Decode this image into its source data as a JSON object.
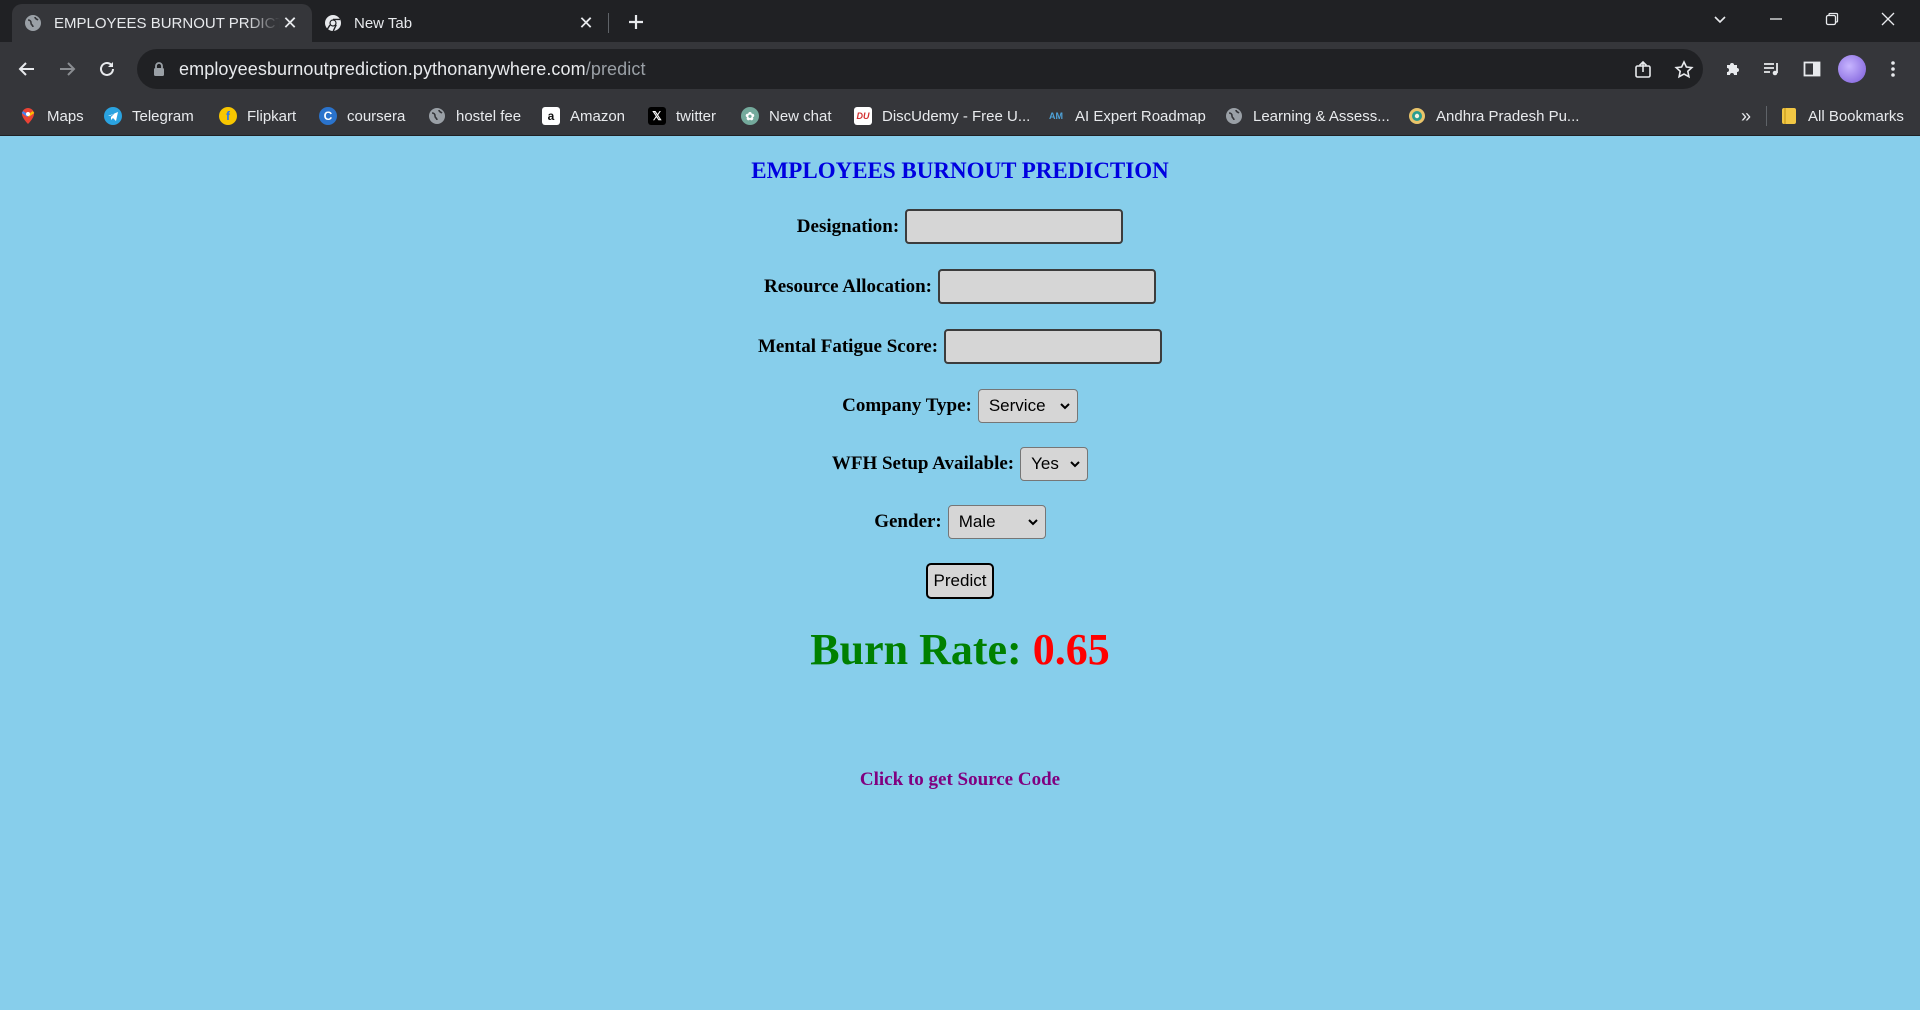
{
  "browser": {
    "tabs": [
      {
        "title": "EMPLOYEES BURNOUT PRDICTIO",
        "active": true
      },
      {
        "title": "New Tab",
        "active": false
      }
    ],
    "url": {
      "domain": "employeesburnoutprediction.pythonanywhere.com",
      "path": "/predict"
    },
    "bookmarks": [
      {
        "label": "Maps",
        "icon": "maps-icon"
      },
      {
        "label": "Telegram",
        "icon": "telegram-icon"
      },
      {
        "label": "Flipkart",
        "icon": "flipkart-icon"
      },
      {
        "label": "coursera",
        "icon": "coursera-icon"
      },
      {
        "label": "hostel fee",
        "icon": "globe-icon"
      },
      {
        "label": "Amazon",
        "icon": "amazon-icon"
      },
      {
        "label": "twitter",
        "icon": "x-icon"
      },
      {
        "label": "New chat",
        "icon": "chatgpt-icon"
      },
      {
        "label": "DiscUdemy - Free U...",
        "icon": "discudemy-icon"
      },
      {
        "label": "AI Expert Roadmap",
        "icon": "roadmap-icon"
      },
      {
        "label": "Learning & Assess...",
        "icon": "globe-icon"
      },
      {
        "label": "Andhra Pradesh Pu...",
        "icon": "ap-emblem-icon"
      }
    ],
    "more_bookmarks": "»",
    "all_bookmarks": "All Bookmarks"
  },
  "page": {
    "heading": "EMPLOYEES BURNOUT PREDICTION",
    "fields": {
      "designation": {
        "label": "Designation:",
        "value": ""
      },
      "resource_allocation": {
        "label": "Resource Allocation:",
        "value": ""
      },
      "mental_fatigue": {
        "label": "Mental Fatigue Score:",
        "value": ""
      },
      "company_type": {
        "label": "Company Type:",
        "selected": "Service"
      },
      "wfh": {
        "label": "WFH Setup Available:",
        "selected": "Yes"
      },
      "gender": {
        "label": "Gender:",
        "selected": "Male"
      }
    },
    "predict_button": "Predict",
    "result": {
      "label": "Burn Rate:",
      "value": "0.65"
    },
    "source_link": "Click to get Source Code",
    "colors": {
      "background": "#87CEEB",
      "heading": "#0000e0",
      "result_label": "#008000",
      "result_value": "#ff0000",
      "link": "#800080"
    }
  }
}
